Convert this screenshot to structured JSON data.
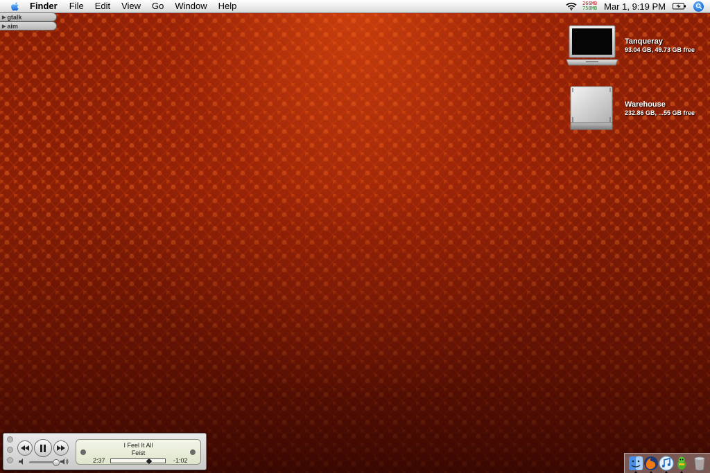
{
  "menubar": {
    "app_name": "Finder",
    "items": [
      "File",
      "Edit",
      "View",
      "Go",
      "Window",
      "Help"
    ],
    "memory": {
      "used": "266MB",
      "free": "758MB",
      "used_color": "#c8141e",
      "free_color": "#1e8c1e"
    },
    "clock": "Mar 1, 9:19 PM"
  },
  "drawers": [
    {
      "label": "gtalk"
    },
    {
      "label": "aim"
    }
  ],
  "volumes": [
    {
      "name": "Tanqueray",
      "info": "93.04 GB, 49.73 GB free",
      "icon": "laptop-icon"
    },
    {
      "name": "Warehouse",
      "info": "232.86 GB, ...55 GB free",
      "icon": "hard-drive-icon"
    }
  ],
  "miniplayer": {
    "song": "I Feel It All",
    "artist": "Feist",
    "elapsed": "2:37",
    "remaining": "-1:02",
    "progress": 0.72,
    "volume": 0.9
  },
  "dock": {
    "items": [
      "finder-icon",
      "firefox-icon",
      "itunes-icon",
      "adium-icon",
      "trash-icon"
    ]
  },
  "colors": {
    "wallpaper": "#8a1f06",
    "wallpaper_highlight": "#ff5a14"
  }
}
